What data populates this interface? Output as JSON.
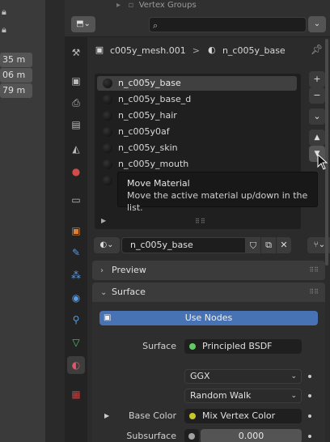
{
  "viewport": {
    "fields": [
      "35 m",
      "06 m",
      "79 m"
    ]
  },
  "outliner": {
    "partial_text": "Vertex Groups"
  },
  "header": {
    "editor_type_icon": "properties-editor-icon",
    "search_placeholder": ""
  },
  "breadcrumb": {
    "object": "c005y_mesh.001",
    "separator": ">",
    "material": "n_c005y_base"
  },
  "tabs": [
    {
      "name": "tool",
      "icon": "tool-icon"
    },
    {
      "name": "render",
      "icon": "render-icon"
    },
    {
      "name": "output",
      "icon": "output-icon"
    },
    {
      "name": "view-layer",
      "icon": "view-layer-icon"
    },
    {
      "name": "scene",
      "icon": "scene-icon"
    },
    {
      "name": "world",
      "icon": "world-icon"
    },
    {
      "name": "collection",
      "icon": "collection-icon"
    },
    {
      "name": "object",
      "icon": "object-icon"
    },
    {
      "name": "modifiers",
      "icon": "wrench-icon"
    },
    {
      "name": "particles",
      "icon": "particles-icon"
    },
    {
      "name": "physics",
      "icon": "physics-icon"
    },
    {
      "name": "constraints",
      "icon": "constraints-icon"
    },
    {
      "name": "data",
      "icon": "mesh-data-icon"
    },
    {
      "name": "material",
      "icon": "material-icon"
    },
    {
      "name": "texture",
      "icon": "texture-icon"
    }
  ],
  "material_slots": [
    "n_c005y_base",
    "n_c005y_base_d",
    "n_c005y_hair",
    "n_c005y0af",
    "n_c005y_skin",
    "n_c005y_mouth",
    ""
  ],
  "slot_buttons": {
    "add": "+",
    "remove": "−",
    "specials": "⌄",
    "up": "▲",
    "down": "▼"
  },
  "tooltip": {
    "title": "Move Material",
    "description": "Move the active material up/down in the list."
  },
  "material_selector": {
    "name": "n_c005y_base"
  },
  "sections": {
    "preview": "Preview",
    "surface": "Surface"
  },
  "surface": {
    "use_nodes": "Use Nodes",
    "surface_label": "Surface",
    "surface_value": "Principled BSDF",
    "distribution": "GGX",
    "subsurface_method": "Random Walk",
    "base_color_label": "Base Color",
    "base_color_value": "Mix Vertex Color",
    "subsurface_label": "Subsurface",
    "subsurface_value": "0.000"
  },
  "colors": {
    "accent_blue": "#4772b3",
    "shader_green": "#63c763",
    "color_socket_yellow": "#c7c729",
    "float_socket_gray": "#a1a1a1"
  }
}
